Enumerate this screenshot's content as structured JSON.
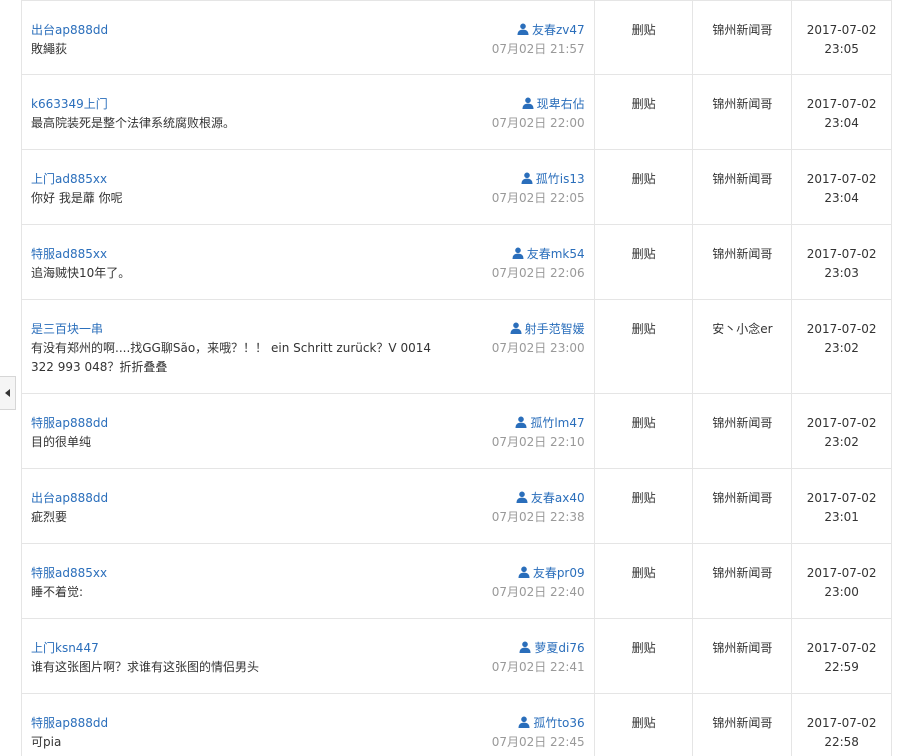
{
  "sidebar_toggle": {
    "icon": "caret-left-icon"
  },
  "posts": [
    {
      "title": "出台ap888dd",
      "content": "敗繩荻",
      "author": "友春zv47",
      "post_time": "07月02日 21:57",
      "action": "删贴",
      "operator": "锦州新闻哥",
      "op_date": "2017-07-02",
      "op_time": "23:05"
    },
    {
      "title": "k663349上门",
      "content": "最高院装死是整个法律系统腐败根源。",
      "author": "现卑右佔",
      "post_time": "07月02日 22:00",
      "action": "删贴",
      "operator": "锦州新闻哥",
      "op_date": "2017-07-02",
      "op_time": "23:04"
    },
    {
      "title": "上门ad885xx",
      "content": "你好 我是蘼 你呢",
      "author": "孤竹is13",
      "post_time": "07月02日 22:05",
      "action": "删贴",
      "operator": "锦州新闻哥",
      "op_date": "2017-07-02",
      "op_time": "23:04"
    },
    {
      "title": "特服ad885xx",
      "content": "追海贼快10年了。",
      "author": "友春mk54",
      "post_time": "07月02日 22:06",
      "action": "删贴",
      "operator": "锦州新闻哥",
      "op_date": "2017-07-02",
      "op_time": "23:03"
    },
    {
      "title": "是三百块一串",
      "content": "有没有郑州的啊....找GG聊São，来哦？！！ ein Schritt zurück？V 0014 322 993 048？折折叠叠",
      "author": "射手范智媛",
      "post_time": "07月02日 23:00",
      "action": "删贴",
      "operator": "安丶小念er",
      "op_date": "2017-07-02",
      "op_time": "23:02"
    },
    {
      "title": "特服ap888dd",
      "content": "目的很单纯",
      "author": "孤竹lm47",
      "post_time": "07月02日 22:10",
      "action": "删贴",
      "operator": "锦州新闻哥",
      "op_date": "2017-07-02",
      "op_time": "23:02"
    },
    {
      "title": "出台ap888dd",
      "content": "疵烈要",
      "author": "友春ax40",
      "post_time": "07月02日 22:38",
      "action": "删贴",
      "operator": "锦州新闻哥",
      "op_date": "2017-07-02",
      "op_time": "23:01"
    },
    {
      "title": "特服ad885xx",
      "content": "睡不着觉:",
      "author": "友春pr09",
      "post_time": "07月02日 22:40",
      "action": "删贴",
      "operator": "锦州新闻哥",
      "op_date": "2017-07-02",
      "op_time": "23:00"
    },
    {
      "title": "上门ksn447",
      "content": "谁有这张图片啊？求谁有这张图的情侣男头",
      "author": "萝夏di76",
      "post_time": "07月02日 22:41",
      "action": "删贴",
      "operator": "锦州新闻哥",
      "op_date": "2017-07-02",
      "op_time": "22:59"
    },
    {
      "title": "特服ap888dd",
      "content": "可pia",
      "author": "孤竹to36",
      "post_time": "07月02日 22:45",
      "action": "删贴",
      "operator": "锦州新闻哥",
      "op_date": "2017-07-02",
      "op_time": "22:58"
    }
  ]
}
